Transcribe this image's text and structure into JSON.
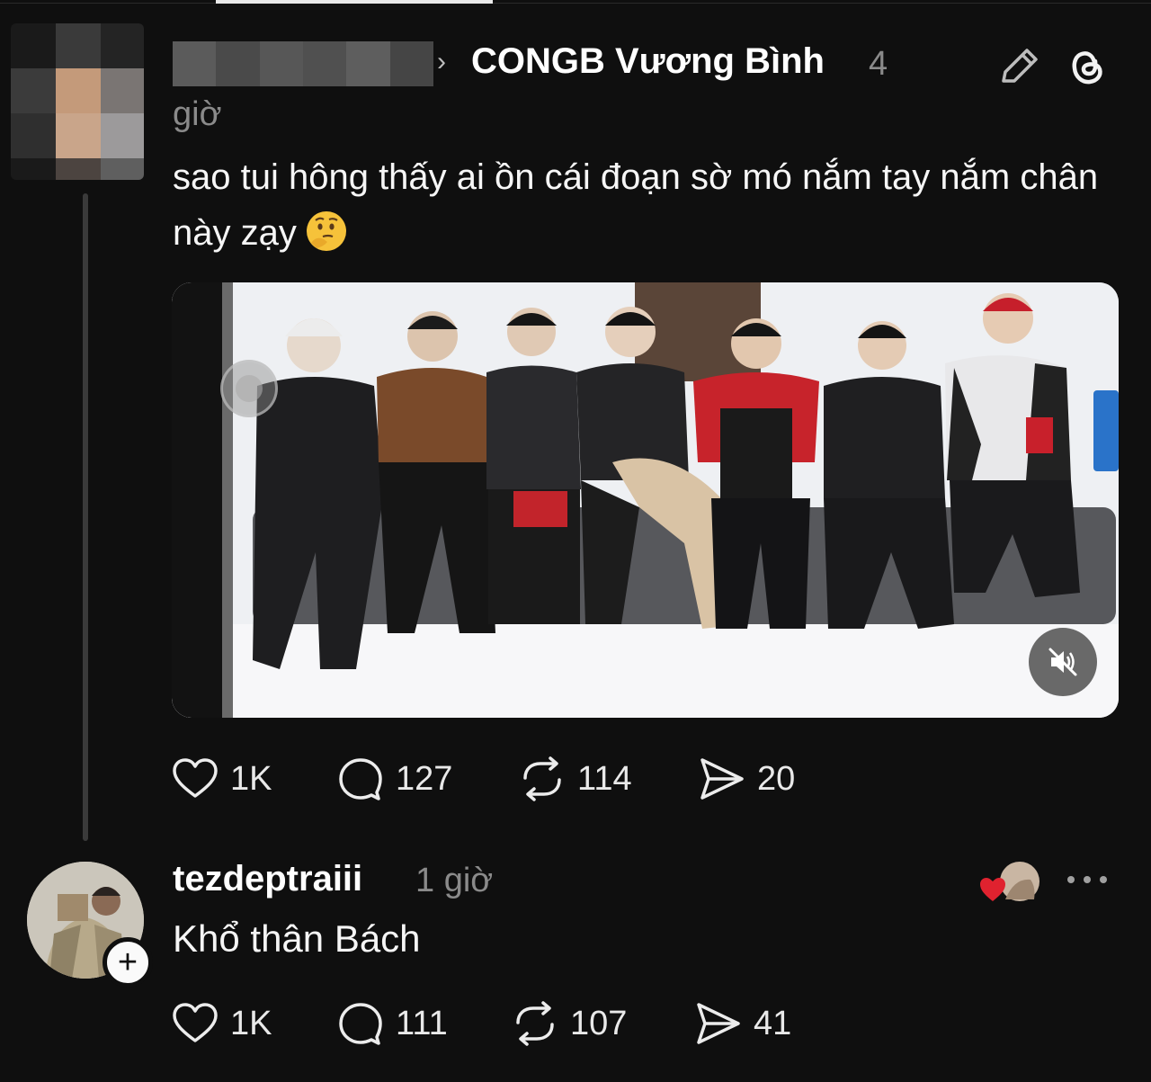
{
  "post": {
    "reply_to_name": "CONGB Vương Bình",
    "time_part_1": "4",
    "time_part_2": "giờ",
    "text": "sao tui hông thấy ai ồn cái đoạn sờ mó nắm tay nắm chân này zạy",
    "emoji_name": "thinking-face-icon",
    "actions": {
      "likes": "1K",
      "comments": "127",
      "reposts": "114",
      "shares": "20"
    }
  },
  "reply": {
    "username": "tezdeptraiii",
    "time": "1 giờ",
    "text": "Khổ thân Bách",
    "actions": {
      "likes": "1K",
      "comments": "111",
      "reposts": "107",
      "shares": "41"
    }
  },
  "colors": {
    "background": "#0f0f0f",
    "text": "#f3f3f3",
    "muted": "#8a8a8a",
    "heart_red": "#e0222f"
  }
}
